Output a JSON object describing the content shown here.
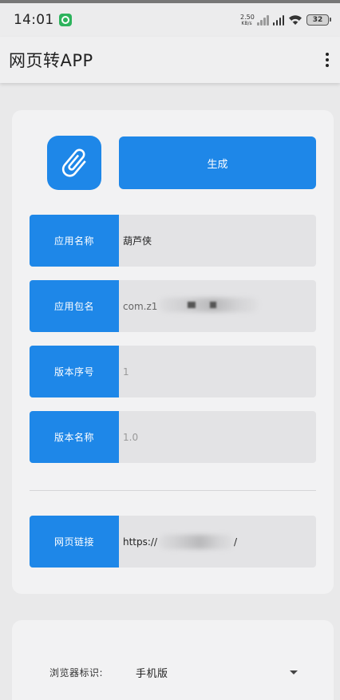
{
  "status_bar": {
    "time": "14:01",
    "net_speed_value": "2.50",
    "net_speed_unit": "KB/s",
    "battery": "32"
  },
  "app_bar": {
    "title": "网页转APP"
  },
  "actions": {
    "attach_icon": "paperclip-icon",
    "generate_label": "生成"
  },
  "fields": [
    {
      "label": "应用名称",
      "value": "葫芦侠",
      "placeholder": ""
    },
    {
      "label": "应用包名",
      "value": "com.z1",
      "placeholder": ""
    },
    {
      "label": "版本序号",
      "value": "",
      "placeholder": "1"
    },
    {
      "label": "版本名称",
      "value": "",
      "placeholder": "1.0"
    }
  ],
  "url_field": {
    "label": "网页链接",
    "value_prefix": "https://",
    "value_suffix": "/"
  },
  "settings": {
    "browser_ua_label": "浏览器标识:",
    "browser_ua_value": "手机版"
  },
  "colors": {
    "accent": "#1e87e8",
    "background": "#e9e9ea",
    "card": "#f2f2f3",
    "input_bg": "#e3e3e5"
  }
}
